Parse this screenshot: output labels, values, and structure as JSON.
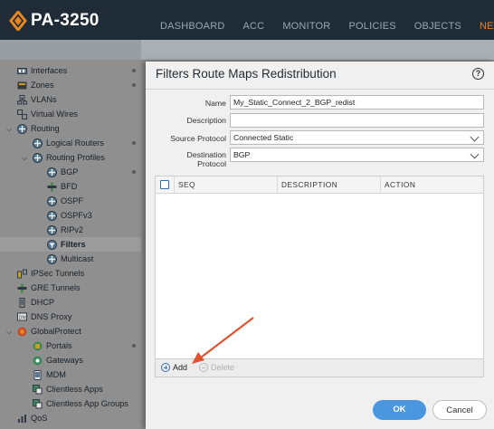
{
  "app": {
    "title": "PA-3250",
    "accent": "#e8861f"
  },
  "nav": {
    "items": [
      "DASHBOARD",
      "ACC",
      "MONITOR",
      "POLICIES",
      "OBJECTS",
      "NETW"
    ],
    "active_index": 5
  },
  "sidebar": {
    "items": [
      {
        "label": "Interfaces",
        "icon": "interfaces-icon"
      },
      {
        "label": "Zones",
        "icon": "zones-icon"
      },
      {
        "label": "VLANs",
        "icon": "vlans-icon"
      },
      {
        "label": "Virtual Wires",
        "icon": "virtual-wires-icon"
      },
      {
        "label": "Routing",
        "icon": "routing-icon"
      },
      {
        "label": "Logical Routers",
        "icon": "router-icon"
      },
      {
        "label": "Routing Profiles",
        "icon": "router-icon"
      },
      {
        "label": "BGP",
        "icon": "router-icon"
      },
      {
        "label": "BFD",
        "icon": "bfd-icon"
      },
      {
        "label": "OSPF",
        "icon": "router-icon"
      },
      {
        "label": "OSPFv3",
        "icon": "router-icon"
      },
      {
        "label": "RIPv2",
        "icon": "router-icon"
      },
      {
        "label": "Filters",
        "icon": "filter-icon"
      },
      {
        "label": "Multicast",
        "icon": "router-icon"
      },
      {
        "label": "IPSec Tunnels",
        "icon": "tunnel-icon"
      },
      {
        "label": "GRE Tunnels",
        "icon": "gre-icon"
      },
      {
        "label": "DHCP",
        "icon": "dhcp-icon"
      },
      {
        "label": "DNS Proxy",
        "icon": "dns-icon"
      },
      {
        "label": "GlobalProtect",
        "icon": "globalprotect-icon"
      },
      {
        "label": "Portals",
        "icon": "portal-icon"
      },
      {
        "label": "Gateways",
        "icon": "gateway-icon"
      },
      {
        "label": "MDM",
        "icon": "mdm-icon"
      },
      {
        "label": "Clientless Apps",
        "icon": "clientless-icon"
      },
      {
        "label": "Clientless App Groups",
        "icon": "clientless-icon"
      },
      {
        "label": "QoS",
        "icon": "qos-icon"
      }
    ],
    "selected": "Filters"
  },
  "dialog": {
    "title": "Filters Route Maps Redistribution",
    "help": "?",
    "fields": {
      "name_label": "Name",
      "name_value": "My_Static_Connect_2_BGP_redist",
      "description_label": "Description",
      "description_value": "",
      "source_protocol_label": "Source Protocol",
      "source_protocol_value": "Connected Static",
      "destination_protocol_label_1": "Destination",
      "destination_protocol_label_2": "Protocol",
      "destination_protocol_value": "BGP"
    },
    "table": {
      "columns": [
        "SEQ",
        "DESCRIPTION",
        "ACTION"
      ],
      "rows": []
    },
    "add_label": "Add",
    "delete_label": "Delete",
    "ok_label": "OK",
    "cancel_label": "Cancel"
  }
}
